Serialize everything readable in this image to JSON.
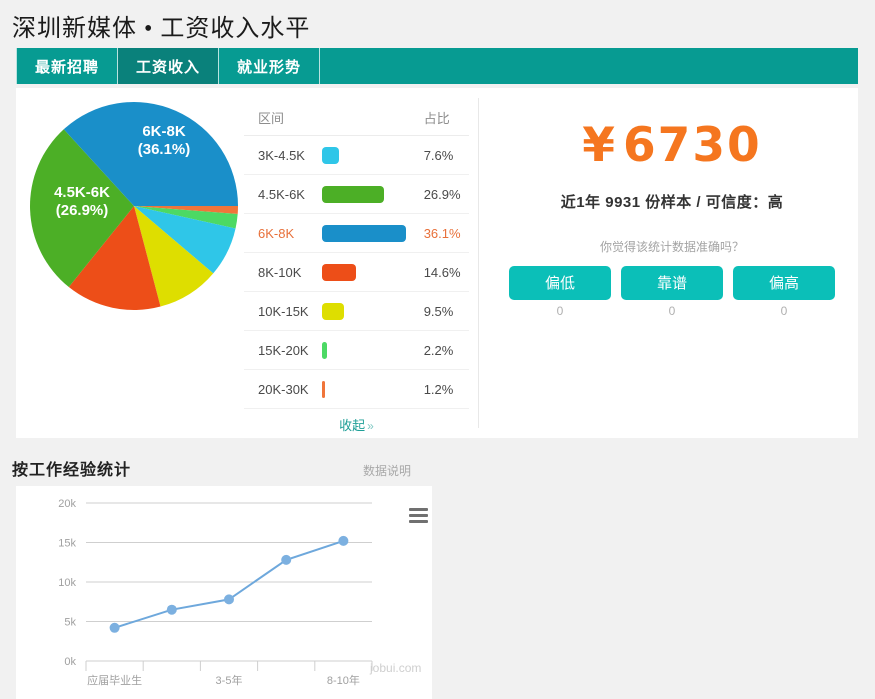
{
  "header": {
    "title": "深圳新媒体 • 工资收入水平",
    "tabs": [
      {
        "label": "最新招聘",
        "active": false
      },
      {
        "label": "工资收入",
        "active": true
      },
      {
        "label": "就业形势",
        "active": false
      }
    ]
  },
  "salary_distribution": {
    "columns": {
      "range": "区间",
      "percent": "占比"
    },
    "collapse_label": "收起",
    "collapse_chevron": "»",
    "highlight_range": "6K-8K",
    "rows": [
      {
        "range": "3K-4.5K",
        "percent": "7.6%",
        "value": 7.6,
        "color": "#2fc6e8"
      },
      {
        "range": "4.5K-6K",
        "percent": "26.9%",
        "value": 26.9,
        "color": "#4caf26"
      },
      {
        "range": "6K-8K",
        "percent": "36.1%",
        "value": 36.1,
        "color": "#1a8fc9"
      },
      {
        "range": "8K-10K",
        "percent": "14.6%",
        "value": 14.6,
        "color": "#ed4e18"
      },
      {
        "range": "10K-15K",
        "percent": "9.5%",
        "value": 9.5,
        "color": "#dede00"
      },
      {
        "range": "15K-20K",
        "percent": "2.2%",
        "value": 2.2,
        "color": "#4cd964"
      },
      {
        "range": "20K-30K",
        "percent": "1.2%",
        "value": 1.2,
        "color": "#f0753a"
      }
    ],
    "pie_labels": [
      {
        "text": "6K-8K",
        "sub": "(36.1%)"
      },
      {
        "text": "4.5K-6K",
        "sub": "(26.9%)"
      }
    ]
  },
  "summary": {
    "currency_symbol": "¥",
    "average_salary": "6730",
    "sample_info": "近1年 9931 份样本 / 可信度：高",
    "vote_question": "你觉得该统计数据准确吗？",
    "votes": [
      {
        "label": "偏低",
        "count": "0"
      },
      {
        "label": "靠谱",
        "count": "0"
      },
      {
        "label": "偏高",
        "count": "0"
      }
    ],
    "accent_orange": "#f5761f",
    "accent_teal": "#0bbfb8"
  },
  "experience_section": {
    "title": "按工作经验统计",
    "data_note": "数据说明",
    "watermark": "jobui.com",
    "menu_icon": "hamburger-icon"
  },
  "chart_data": {
    "type": "line",
    "title": "按工作经验统计",
    "xlabel": "",
    "ylabel": "",
    "categories": [
      "应届毕业生",
      "",
      "3-5年",
      "",
      "8-10年"
    ],
    "tick_labels": [
      "应届毕业生",
      "3-5年",
      "8-10年"
    ],
    "x": [
      0,
      1,
      2,
      3,
      4
    ],
    "values": [
      4200,
      6500,
      7800,
      12800,
      15200
    ],
    "ylim": [
      0,
      20000
    ],
    "yticks": [
      0,
      5000,
      10000,
      15000,
      20000
    ],
    "ytick_labels": [
      "0k",
      "5k",
      "10k",
      "15k",
      "20k"
    ],
    "grid": true,
    "legend": false,
    "line_color": "#6ea8dc",
    "marker_color": "#7cb0e0"
  }
}
